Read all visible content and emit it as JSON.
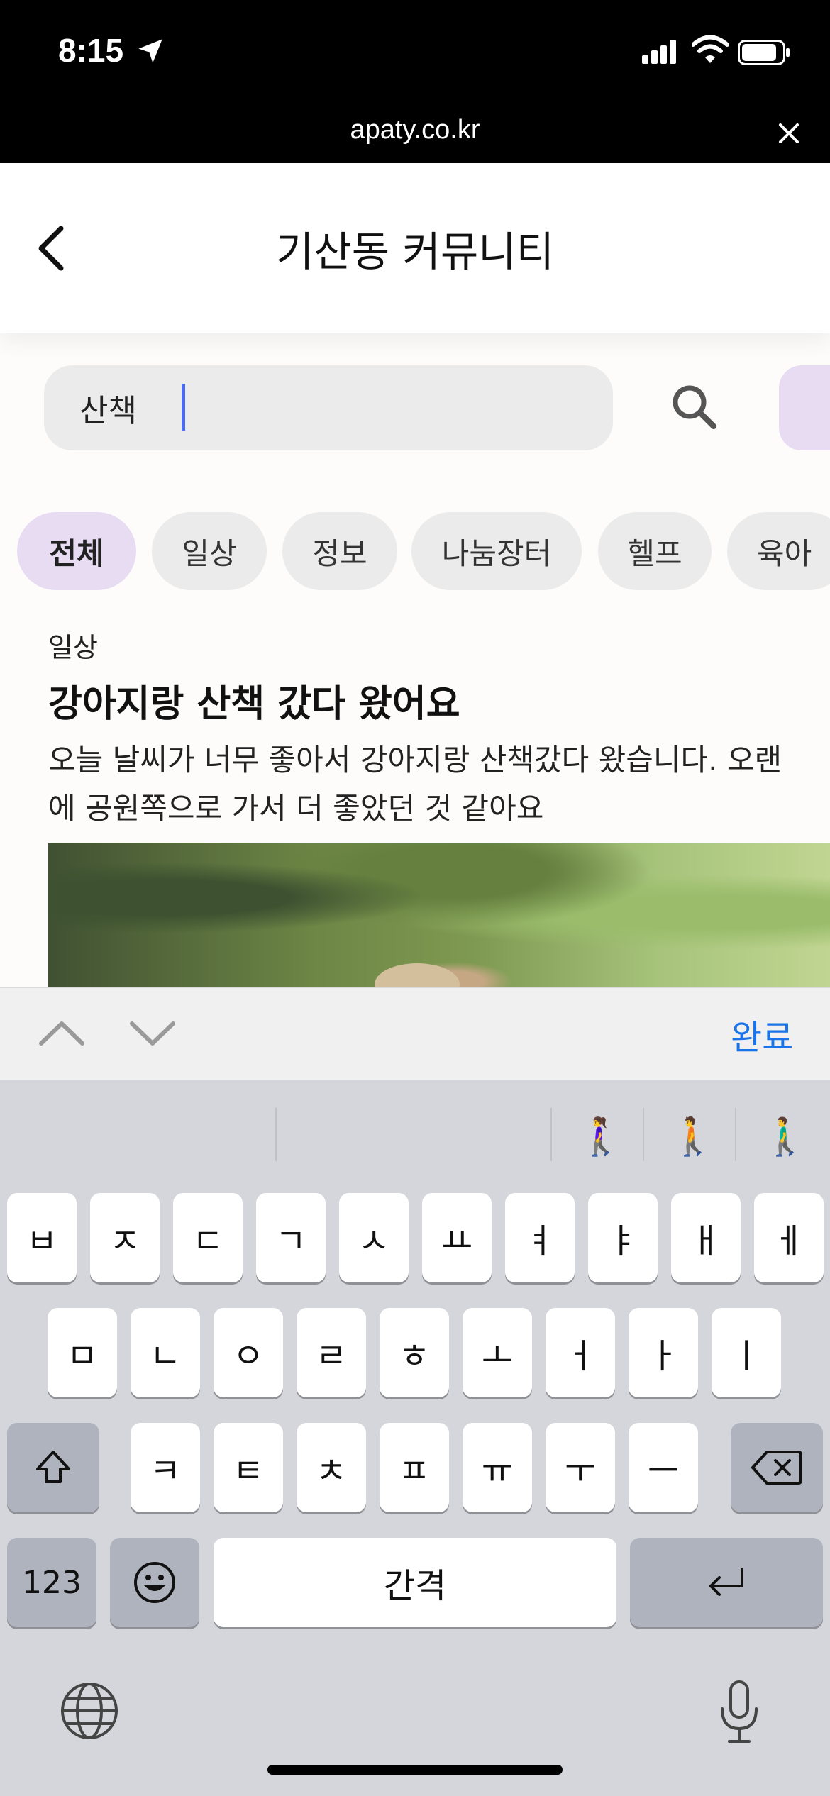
{
  "status_bar": {
    "time": "8:15"
  },
  "url_bar": {
    "url": "apaty.co.kr"
  },
  "header": {
    "title": "기산동 커뮤니티"
  },
  "search": {
    "value": "산책"
  },
  "chips": [
    {
      "label": "전체",
      "active": true
    },
    {
      "label": "일상",
      "active": false
    },
    {
      "label": "정보",
      "active": false
    },
    {
      "label": "나눔장터",
      "active": false
    },
    {
      "label": "헬프",
      "active": false
    },
    {
      "label": "육아",
      "active": false
    }
  ],
  "post": {
    "category": "일상",
    "title": "강아지랑 산책 갔다 왔어요",
    "body_line1": "오늘 날씨가 너무 좋아서 강아지랑 산책갔다 왔습니다.  오랜",
    "body_line2": "에 공원쪽으로 가서 더 좋았던 것 같아요"
  },
  "accessory": {
    "done_label": "완료"
  },
  "keyboard": {
    "suggestions": [
      "🚶‍♀️",
      "🚶",
      "🚶‍♂️"
    ],
    "row1": [
      "ㅂ",
      "ㅈ",
      "ㄷ",
      "ㄱ",
      "ㅅ",
      "ㅛ",
      "ㅕ",
      "ㅑ",
      "ㅐ",
      "ㅔ"
    ],
    "row2": [
      "ㅁ",
      "ㄴ",
      "ㅇ",
      "ㄹ",
      "ㅎ",
      "ㅗ",
      "ㅓ",
      "ㅏ",
      "ㅣ"
    ],
    "row3": [
      "ㅋ",
      "ㅌ",
      "ㅊ",
      "ㅍ",
      "ㅠ",
      "ㅜ",
      "ㅡ"
    ],
    "numbers_label": "123",
    "space_label": "간격"
  },
  "colors": {
    "accent": "#e8dcf3",
    "done": "#1a73e8",
    "caret": "#4b6cf0"
  }
}
